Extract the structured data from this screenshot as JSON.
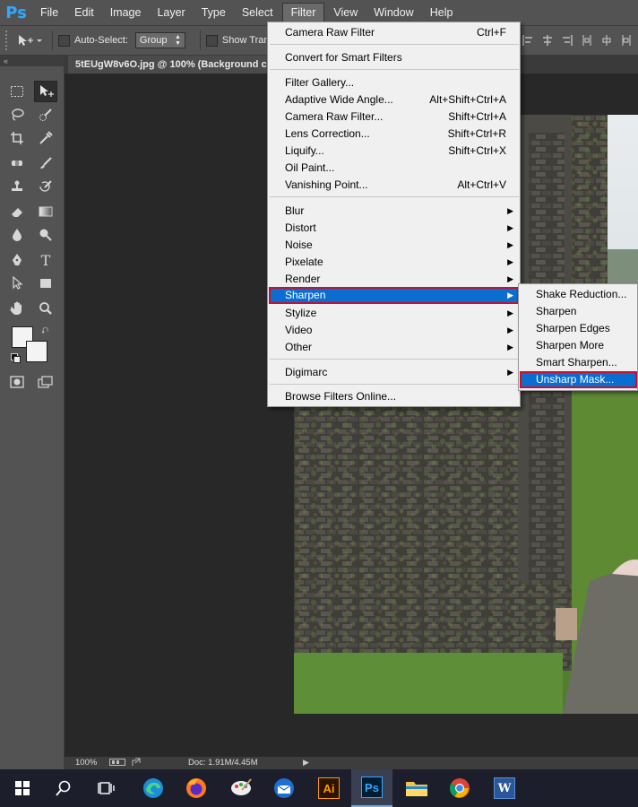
{
  "app": {
    "logo": "Ps"
  },
  "menubar": {
    "items": [
      "File",
      "Edit",
      "Image",
      "Layer",
      "Type",
      "Select",
      "Filter",
      "View",
      "Window",
      "Help"
    ],
    "active": "Filter"
  },
  "options_bar": {
    "auto_select_label": "Auto-Select:",
    "auto_select_value": "Group",
    "show_transform_label": "Show Tran"
  },
  "document": {
    "tab_title": "5tEUgW8v6O.jpg @ 100% (Background co"
  },
  "panel": {
    "collapse_glyph": "«"
  },
  "status_bar": {
    "zoom": "100%",
    "doc_info": "Doc: 1.91M/4.45M"
  },
  "filter_menu": {
    "items": [
      {
        "label": "Camera Raw Filter",
        "shortcut": "Ctrl+F"
      },
      {
        "label": "Convert for Smart Filters"
      },
      {
        "label": "Filter Gallery..."
      },
      {
        "label": "Adaptive Wide Angle...",
        "shortcut": "Alt+Shift+Ctrl+A"
      },
      {
        "label": "Camera Raw Filter...",
        "shortcut": "Shift+Ctrl+A"
      },
      {
        "label": "Lens Correction...",
        "shortcut": "Shift+Ctrl+R"
      },
      {
        "label": "Liquify...",
        "shortcut": "Shift+Ctrl+X"
      },
      {
        "label": "Oil Paint..."
      },
      {
        "label": "Vanishing Point...",
        "shortcut": "Alt+Ctrl+V"
      },
      {
        "label": "Blur"
      },
      {
        "label": "Distort"
      },
      {
        "label": "Noise"
      },
      {
        "label": "Pixelate"
      },
      {
        "label": "Render"
      },
      {
        "label": "Sharpen"
      },
      {
        "label": "Stylize"
      },
      {
        "label": "Video"
      },
      {
        "label": "Other"
      },
      {
        "label": "Digimarc"
      },
      {
        "label": "Browse Filters Online..."
      }
    ],
    "highlighted": "Sharpen"
  },
  "sharpen_submenu": {
    "items": [
      "Shake Reduction...",
      "Sharpen",
      "Sharpen Edges",
      "Sharpen More",
      "Smart Sharpen...",
      "Unsharp Mask..."
    ],
    "highlighted": "Unsharp Mask..."
  },
  "taskbar": {
    "apps": [
      "start",
      "search",
      "task-view",
      "edge",
      "firefox",
      "paint",
      "thunderbird",
      "illustrator",
      "photoshop",
      "file-explorer",
      "chrome",
      "word"
    ],
    "active": "photoshop",
    "illustrator_label": "Ai",
    "photoshop_label": "Ps",
    "word_label": "W"
  },
  "colors": {
    "ui_panel": "#535353",
    "canvas_bg": "#282828",
    "menu_bg": "#f0f0f0",
    "menu_highlight": "#0a6ed1",
    "callout_outline": "#c8102e",
    "ps_blue": "#31a8ff"
  }
}
